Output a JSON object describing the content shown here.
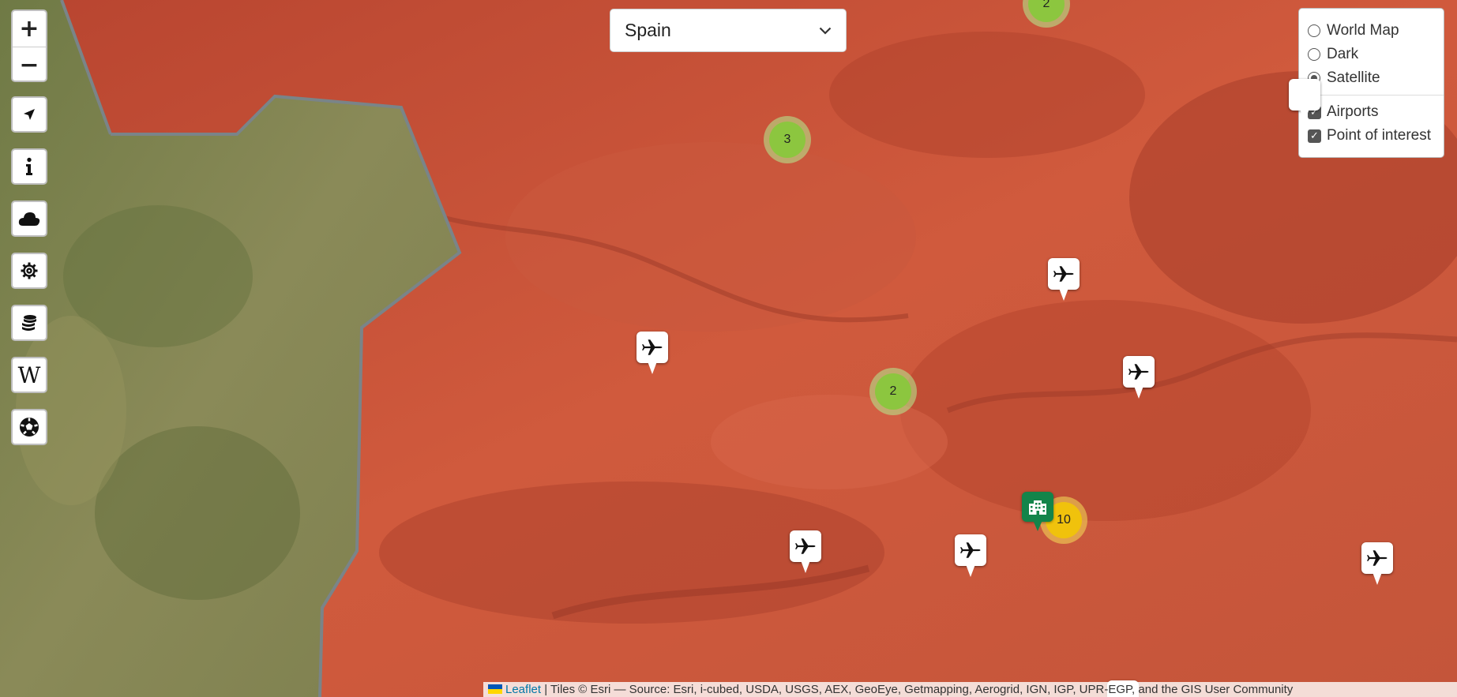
{
  "map": {
    "basemap": "satellite",
    "highlight_color": "#d8563a",
    "border_color": "#7a8488"
  },
  "toolbar": {
    "zoom_in": "+",
    "zoom_out": "−",
    "buttons": [
      "locate-icon",
      "info-icon",
      "weather-icon",
      "settings-icon",
      "currency-icon",
      "wikipedia-icon",
      "football-icon"
    ],
    "wiki_label": "W"
  },
  "country_select": {
    "value": "Spain"
  },
  "layer_control": {
    "base_layers": [
      {
        "label": "World Map",
        "selected": false
      },
      {
        "label": "Dark",
        "selected": false
      },
      {
        "label": "Satellite",
        "selected": true
      }
    ],
    "overlays": [
      {
        "label": "Airports",
        "checked": true
      },
      {
        "label": "Point of interest",
        "checked": true
      }
    ]
  },
  "clusters": [
    {
      "count": "2",
      "color": "#8cc63f"
    },
    {
      "count": "3",
      "color": "#8cc63f"
    },
    {
      "count": "2",
      "color": "#8cc63f"
    },
    {
      "count": "10",
      "color": "#f0c20c"
    }
  ],
  "markers": {
    "airport_icon": "plane-icon",
    "poi_icon": "building-icon",
    "poi_color": "#13844a"
  },
  "attribution": {
    "link": "Leaflet",
    "text": "| Tiles © Esri — Source: Esri, i-cubed, USDA, USGS, AEX, GeoEye, Getmapping, Aerogrid, IGN, IGP, UPR-EGP, and the GIS User Community"
  }
}
